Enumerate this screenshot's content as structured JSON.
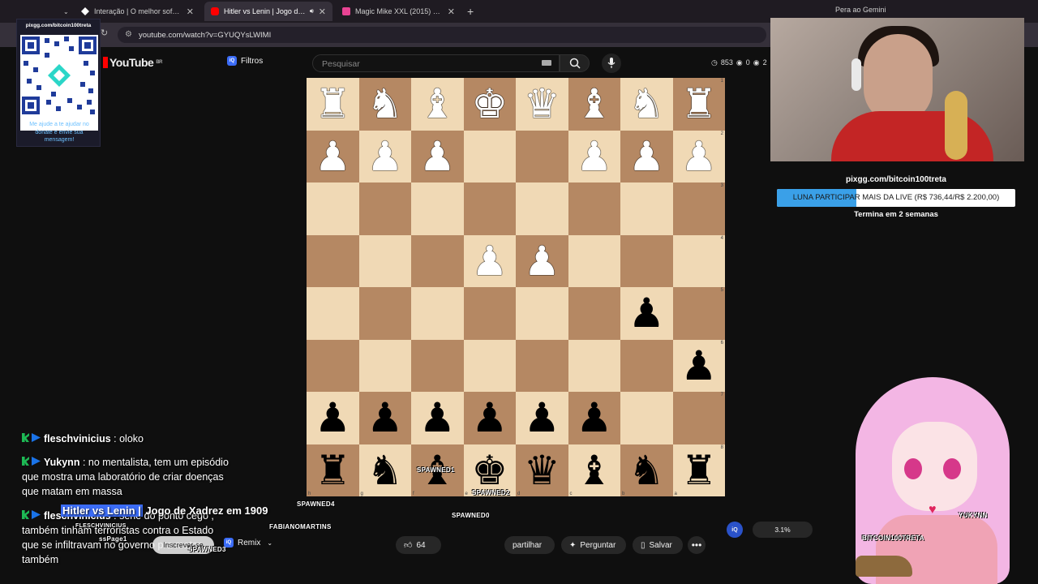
{
  "browser": {
    "tabs": [
      {
        "label": "Interação | O melhor software p",
        "active": false,
        "fav_color": "#ffffff"
      },
      {
        "label": "Hitler vs Lenin | Jogo de Xa",
        "active": true,
        "fav_color": "#ff0000"
      },
      {
        "label": "Magic Mike XXL (2015) Comédi",
        "active": false,
        "fav_color": "#e84393"
      }
    ],
    "url": "youtube.com/watch?v=GYUQYsLWIMI",
    "gemini_label": "Pera ao Gemini"
  },
  "youtube": {
    "logo": "YouTube",
    "region": "BR",
    "filtros_label": "Filtros",
    "iq": "iQ",
    "search_placeholder": "Pesquisar",
    "stats": [
      "853",
      "0",
      "2"
    ]
  },
  "overlay_qr": {
    "top_text": "pixgg.com/bitcoin100treta",
    "bottom_text": "Me ajude a te ajudar no donate e envie sua mensagem!"
  },
  "board": {
    "ranks": [
      "1",
      "2",
      "3",
      "4",
      "5",
      "6",
      "7",
      "8"
    ],
    "files": [
      "h",
      "g",
      "f",
      "e",
      "d",
      "c",
      "b",
      "a"
    ],
    "rows": [
      [
        "wR",
        "wN",
        "wB",
        "wK",
        "wQ",
        "wB",
        "wN",
        "wR"
      ],
      [
        "wP",
        "wP",
        "wP",
        "",
        "",
        "wP",
        "wP",
        "wP"
      ],
      [
        "",
        "",
        "",
        "",
        "",
        "",
        "",
        ""
      ],
      [
        "",
        "",
        "",
        "wP",
        "wP",
        "",
        "",
        ""
      ],
      [
        "",
        "",
        "",
        "",
        "",
        "",
        "bP",
        ""
      ],
      [
        "",
        "",
        "",
        "",
        "",
        "",
        "",
        "bP"
      ],
      [
        "bP",
        "bP",
        "bP",
        "bP",
        "bP",
        "bP",
        "",
        ""
      ],
      [
        "bR",
        "bN",
        "bB",
        "bK",
        "bQ",
        "bB",
        "bN",
        "bR"
      ]
    ]
  },
  "donation": {
    "url": "pixgg.com/bitcoin100treta",
    "bar_text": "LUNA PARTICIPAR MAIS DA LIVE (R$ 736,44/R$ 2.200,00)",
    "current": 736.44,
    "goal": 2200.0,
    "fill_color": "#3aa0e8",
    "ends_text": "Termina em 2 semanas"
  },
  "chat": [
    {
      "user": "fleschvinicius",
      "message": "oloko"
    },
    {
      "user": "Yukynn",
      "message": "no mentalista, tem um episódio que mostra uma laboratório de criar doenças que matam em massa"
    },
    {
      "user": "fleschvinicius",
      "message": "serie do ponto cego , também tinham terroristas contra o Estado que se infiltravam no governo pra matar também"
    }
  ],
  "video": {
    "title_highlight": "Hitler vs Lenin |",
    "title_rest": " Jogo de Xadrez em 1909",
    "subscribe_label": "Inscrever-se",
    "remix_label": "Remix",
    "likes": "64",
    "share_label": "partilhar",
    "ask_label": "Perguntar",
    "save_label": "Salvar",
    "watch_percent": "3.1%"
  },
  "sprites": [
    "SPAWNED1",
    "SPAWNED2",
    "SPAWNED4",
    "FABIANOMARTINS",
    "SPAWNED0",
    "SPAWNED3",
    "FLESCHVINICIUS",
    "ssPage1",
    "YUKYNN",
    "BITCOIN100TRETA"
  ]
}
